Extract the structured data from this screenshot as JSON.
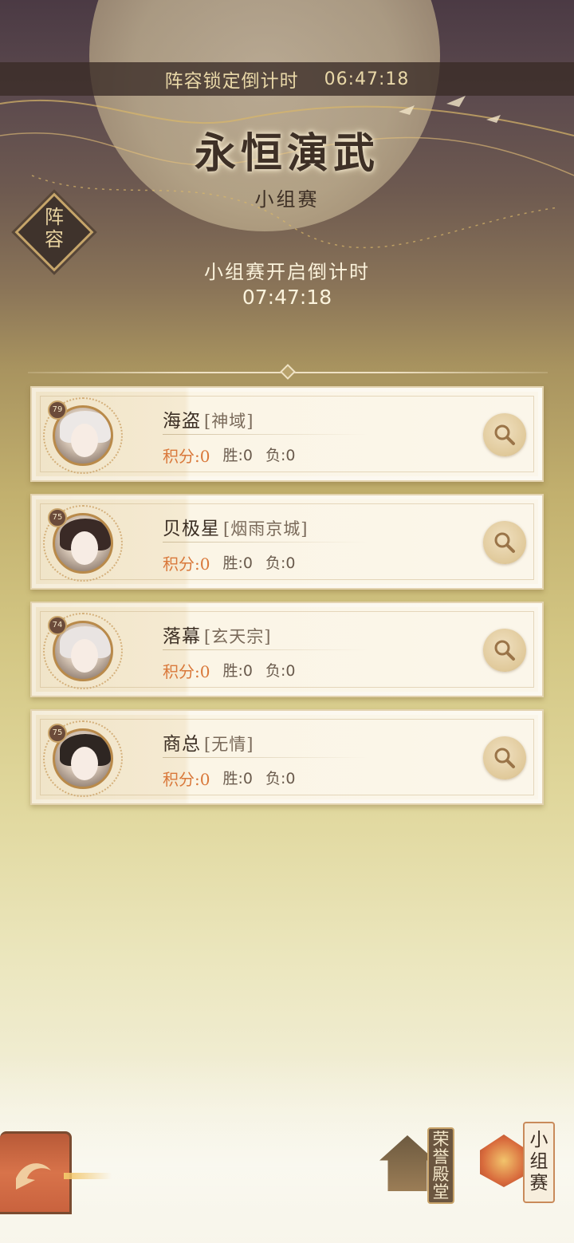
{
  "header": {
    "lock_label": "阵容锁定倒计时",
    "lock_time": "06:47:18",
    "title": "永恒演武",
    "subtitle": "小组赛"
  },
  "lineup_button": {
    "chars": [
      "阵",
      "容"
    ]
  },
  "countdown": {
    "label": "小组赛开启倒计时",
    "time": "07:47:18"
  },
  "players": [
    {
      "level": "79",
      "name": "海盗",
      "guild": "[神域]",
      "score": "积分:0",
      "wins": "胜:0",
      "losses": "负:0",
      "hair": "#ece8e6"
    },
    {
      "level": "75",
      "name": "贝极星",
      "guild": "[烟雨京城]",
      "score": "积分:0",
      "wins": "胜:0",
      "losses": "负:0",
      "hair": "#3a2a26"
    },
    {
      "level": "74",
      "name": "落幕",
      "guild": "[玄天宗]",
      "score": "积分:0",
      "wins": "胜:0",
      "losses": "负:0",
      "hair": "#e9e4e2"
    },
    {
      "level": "75",
      "name": "商总",
      "guild": "[无情]",
      "score": "积分:0",
      "wins": "胜:0",
      "losses": "负:0",
      "hair": "#2e2622"
    }
  ],
  "bottom_nav": {
    "hall_chars": [
      "荣",
      "誉",
      "殿",
      "堂"
    ],
    "group_chars": [
      "小",
      "组",
      "赛"
    ]
  },
  "icons": {
    "search": "magnifier-icon",
    "back": "back-arrow-icon"
  }
}
